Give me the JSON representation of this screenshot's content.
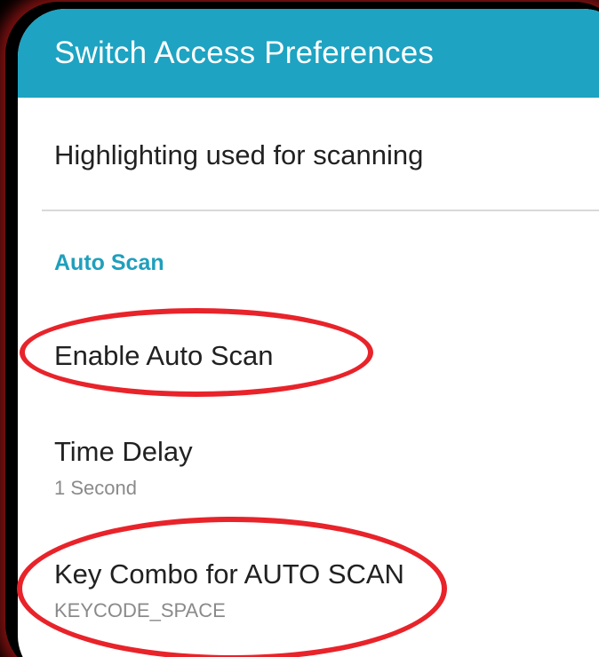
{
  "appbar": {
    "title": "Switch Access Preferences",
    "color": "#1ea3c2"
  },
  "preferences": {
    "highlighting": {
      "title": "Highlighting used for scanning"
    },
    "auto_scan_category": {
      "label": "Auto Scan"
    },
    "enable_auto_scan": {
      "title": "Enable Auto Scan"
    },
    "time_delay": {
      "title": "Time Delay",
      "summary": "1 Second"
    },
    "key_combo": {
      "title": "Key Combo for AUTO SCAN",
      "summary": "KEYCODE_SPACE"
    }
  },
  "annotations": {
    "color": "#e8232a",
    "circled_items": [
      "Enable Auto Scan",
      "Key Combo for AUTO SCAN"
    ]
  }
}
